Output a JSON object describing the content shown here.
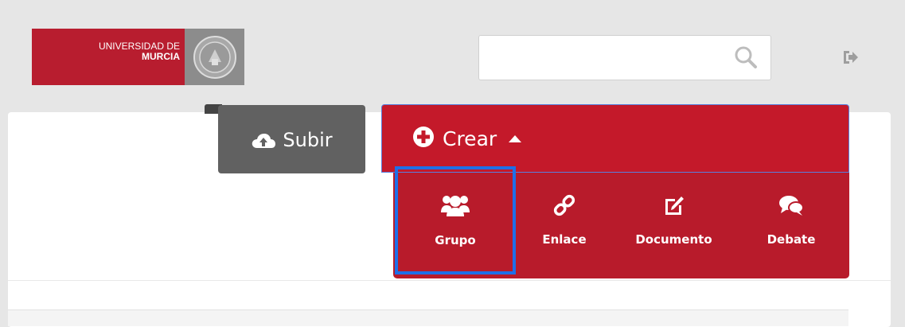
{
  "header": {
    "logo": {
      "line1": "UNIVERSIDAD DE",
      "line2": "MURCIA"
    },
    "search": {
      "value": "",
      "placeholder": "",
      "icon": "search-icon"
    },
    "logout_icon": "logout-icon"
  },
  "toolbar": {
    "subir": {
      "label": "Subir",
      "icon": "cloud-upload-icon"
    },
    "crear": {
      "label": "Crear",
      "icon": "plus-circle-icon",
      "caret": "caret-up-icon"
    },
    "crear_menu": [
      {
        "label": "Grupo",
        "icon": "users-icon",
        "selected": true
      },
      {
        "label": "Enlace",
        "icon": "link-icon"
      },
      {
        "label": "Documento",
        "icon": "edit-icon"
      },
      {
        "label": "Debate",
        "icon": "comments-icon"
      }
    ]
  },
  "colors": {
    "brand_red": "#c4192a",
    "menu_red": "#b81b2b",
    "subir_gray": "#616161",
    "highlight_blue": "#1f6fe8",
    "header_bg": "#e6e6e6"
  }
}
